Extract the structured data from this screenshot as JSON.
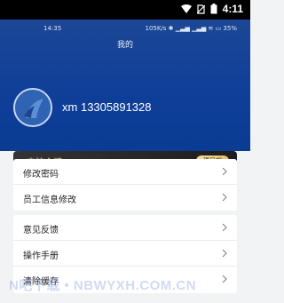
{
  "system_status": {
    "time": "4:11"
  },
  "inner_status": {
    "time": "14:35",
    "right": "105K/s ✱ ▁▃▅ ▁▃▅ ≋ ▭ 35%"
  },
  "header": {
    "title": "我的"
  },
  "user": {
    "name": "xm",
    "phone": "13305891328"
  },
  "company": {
    "name": "宁波众骋",
    "tag": "项目部"
  },
  "menu_group_1": [
    {
      "label": "修改密码"
    },
    {
      "label": "员工信息修改"
    }
  ],
  "menu_group_2": [
    {
      "label": "意见反馈"
    },
    {
      "label": "操作手册"
    },
    {
      "label": "清除缓存"
    }
  ],
  "watermark": "N吧下载 • NBWYXH.COM.CN",
  "colors": {
    "header_blue": "#0f3f98",
    "tag_gold": "#e7c36c",
    "company_text": "#e8c77b"
  }
}
